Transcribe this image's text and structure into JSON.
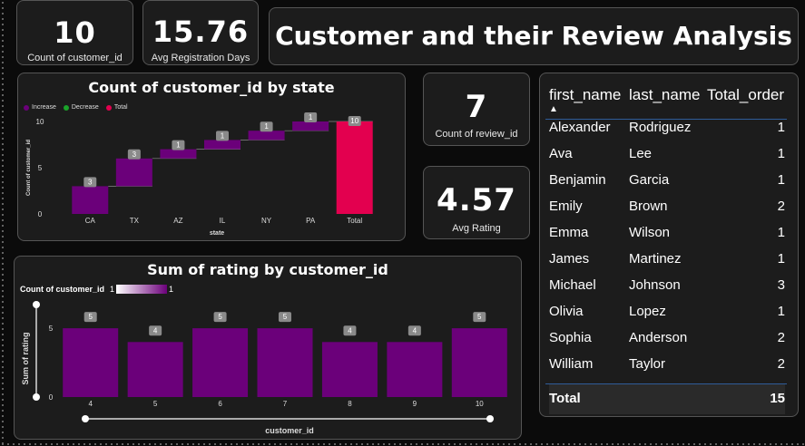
{
  "kpis": {
    "customers": {
      "value": "10",
      "label": "Count of customer_id"
    },
    "registration": {
      "value": "15.76",
      "label": "Avg Registration Days"
    },
    "reviews": {
      "value": "7",
      "label": "Count of review_id"
    },
    "rating": {
      "value": "4.57",
      "label": "Avg Rating"
    }
  },
  "main_title": "Customer and their Review Analysis",
  "colors": {
    "increase": "#6b007a",
    "decrease": "#1aa32a",
    "total": "#e3004f",
    "bar": "#6b007a",
    "panel": "#1c1c1c",
    "border": "#555555"
  },
  "waterfall_legend": [
    {
      "label": "Increase",
      "color": "#6b007a"
    },
    {
      "label": "Decrease",
      "color": "#1aa32a"
    },
    {
      "label": "Total",
      "color": "#e3004f"
    }
  ],
  "chart_data": [
    {
      "type": "bar",
      "subtype": "waterfall",
      "title": "Count of customer_id by state",
      "xlabel": "state",
      "ylabel": "Count of customer_id",
      "categories": [
        "CA",
        "TX",
        "AZ",
        "IL",
        "NY",
        "PA",
        "Total"
      ],
      "values": [
        3,
        3,
        1,
        1,
        1,
        1,
        10
      ],
      "kinds": [
        "increase",
        "increase",
        "increase",
        "increase",
        "increase",
        "increase",
        "total"
      ],
      "yticks": [
        0,
        5,
        10
      ],
      "ylim": [
        0,
        10
      ]
    },
    {
      "type": "bar",
      "title": "Sum of rating by customer_id",
      "xlabel": "customer_id",
      "ylabel": "Sum of rating",
      "color_legend_label": "Count of customer_id",
      "color_legend_min": "1",
      "color_legend_max": "1",
      "categories": [
        "4",
        "5",
        "6",
        "7",
        "8",
        "9",
        "10"
      ],
      "values": [
        5,
        4,
        5,
        5,
        4,
        4,
        5
      ],
      "yticks": [
        0,
        5
      ],
      "ylim": [
        0,
        5.6
      ]
    }
  ],
  "table": {
    "columns": [
      "first_name",
      "last_name",
      "Total_order"
    ],
    "sort_indicator": "▲",
    "rows": [
      [
        "Alexander",
        "Rodriguez",
        "1"
      ],
      [
        "Ava",
        "Lee",
        "1"
      ],
      [
        "Benjamin",
        "Garcia",
        "1"
      ],
      [
        "Emily",
        "Brown",
        "2"
      ],
      [
        "Emma",
        "Wilson",
        "1"
      ],
      [
        "James",
        "Martinez",
        "1"
      ],
      [
        "Michael",
        "Johnson",
        "3"
      ],
      [
        "Olivia",
        "Lopez",
        "1"
      ],
      [
        "Sophia",
        "Anderson",
        "2"
      ],
      [
        "William",
        "Taylor",
        "2"
      ]
    ],
    "total_label": "Total",
    "total_value": "15"
  }
}
